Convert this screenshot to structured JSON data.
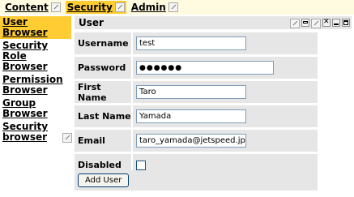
{
  "tabs": [
    {
      "label": "Content",
      "active": false
    },
    {
      "label": "Security",
      "active": true
    },
    {
      "label": "Admin",
      "active": false
    }
  ],
  "leftnav": [
    {
      "label": "User Browser",
      "active": true
    },
    {
      "label": "Security Role Browser"
    },
    {
      "label": "Permission Browser"
    },
    {
      "label": "Group Browser"
    },
    {
      "label": "Security browser"
    }
  ],
  "portlet": {
    "title": "User",
    "icons": [
      "edit-icon",
      "print-icon",
      "help-icon",
      "close-icon",
      "minimize-icon",
      "maximize-icon"
    ]
  },
  "form": {
    "username": {
      "label": "Username",
      "value": "test"
    },
    "password": {
      "label": "Password",
      "value": "●●●●●●"
    },
    "first_name": {
      "label": "First Name",
      "value": "Taro"
    },
    "last_name": {
      "label": "Last Name",
      "value": "Yamada"
    },
    "email": {
      "label": "Email",
      "value": "taro_yamada@jetspeed.jp"
    },
    "disabled": {
      "label": "Disabled",
      "checked": false
    },
    "submit_label": "Add User"
  },
  "colors": {
    "tab_active": "#ffcc33",
    "tabbar_bg": "#fefbe0",
    "panel_bg": "#e6e6e6"
  }
}
